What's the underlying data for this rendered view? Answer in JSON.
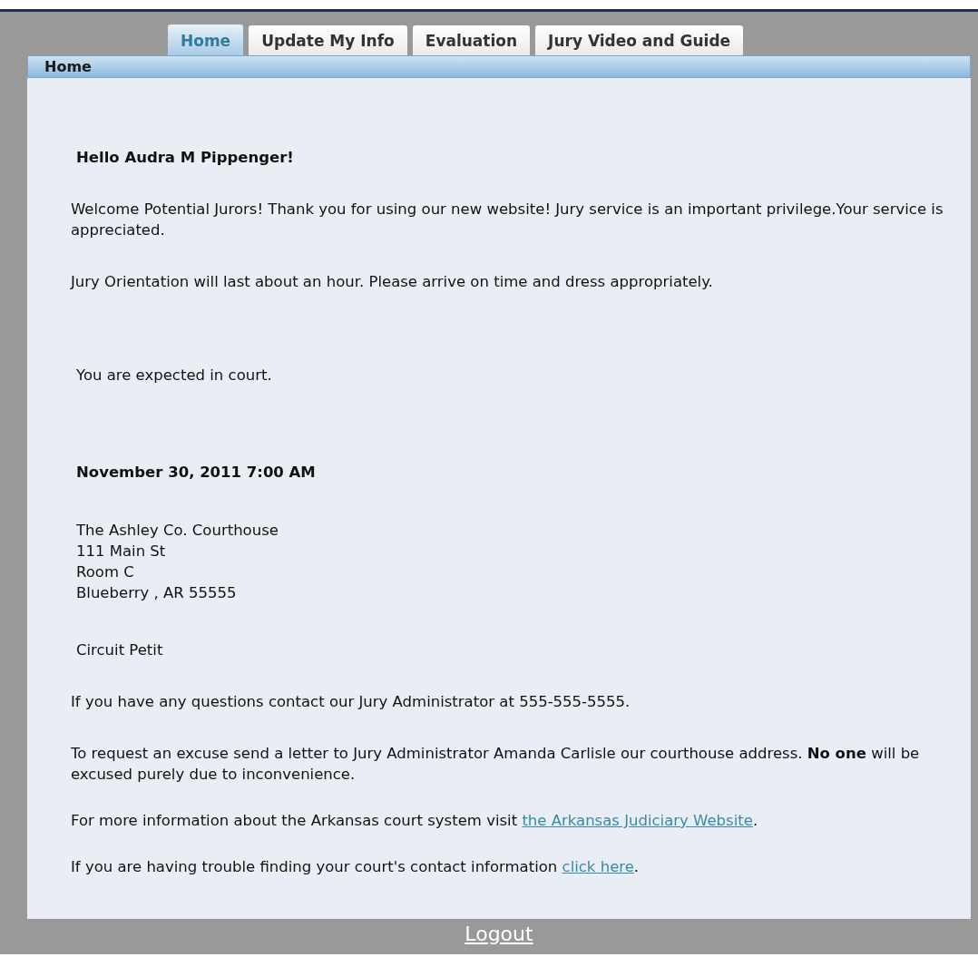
{
  "tabs": [
    {
      "label": "Home",
      "selected": true
    },
    {
      "label": "Update My Info",
      "selected": false
    },
    {
      "label": "Evaluation",
      "selected": false
    },
    {
      "label": "Jury Video and Guide",
      "selected": false
    }
  ],
  "panel": {
    "title": "Home"
  },
  "blocks": [
    {
      "kind": "greeting",
      "text": "Hello Audra M Pippenger!"
    },
    {
      "kind": "para",
      "text": "Welcome Potential Jurors! Thank you for using our new website! Jury service is an important privilege.Your service is appreciated."
    },
    {
      "kind": "para",
      "text": "Jury Orientation will last about an hour. Please arrive on time and dress appropriately."
    },
    {
      "kind": "notice",
      "text": "You are expected in court."
    },
    {
      "kind": "datetime",
      "text": "November 30, 2011 7:00 AM"
    },
    {
      "kind": "address",
      "lines": [
        "The Ashley Co. Courthouse",
        "111 Main St",
        "Room C",
        "Blueberry , AR 55555"
      ]
    },
    {
      "kind": "court",
      "text": "Circuit Petit"
    },
    {
      "kind": "para",
      "text": "If you have any questions contact our Jury Administrator at 555-555-5555."
    },
    {
      "kind": "para",
      "text": "To request an excuse send a letter to Jury Administrator Amanda Carlisle our courthouse address. **No one** will be excused purely due to inconvenience."
    },
    {
      "kind": "link",
      "before": "For more information about the Arkansas court system visit ",
      "link": "the Arkansas Judiciary Website",
      "after": "."
    },
    {
      "kind": "link",
      "before": "If you are having trouble finding your court's contact information ",
      "link": "click here",
      "after": "."
    }
  ],
  "footer": {
    "link": "Logout"
  }
}
